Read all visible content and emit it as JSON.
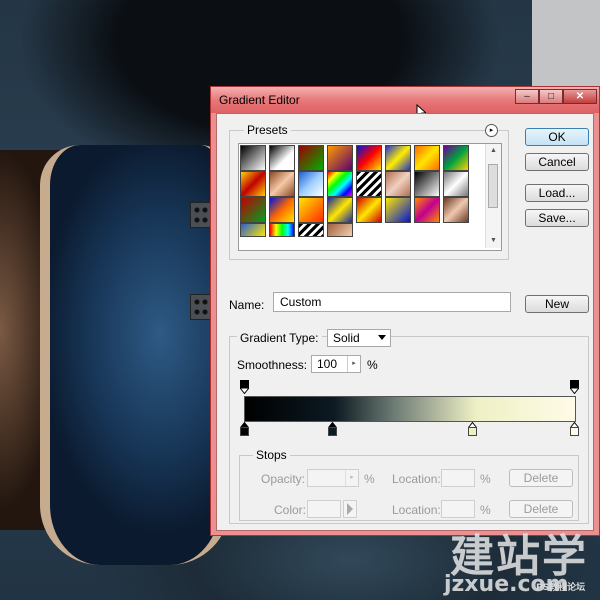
{
  "window": {
    "title": "Gradient Editor",
    "min_glyph": "‒",
    "max_glyph": "□",
    "close_glyph": "✕"
  },
  "presets": {
    "label": "Presets",
    "menu_glyph": "▸"
  },
  "buttons": {
    "ok": "OK",
    "cancel": "Cancel",
    "load": "Load...",
    "save": "Save...",
    "new": "New"
  },
  "name": {
    "label": "Name:",
    "value": "Custom"
  },
  "gradient_type": {
    "label": "Gradient Type:",
    "value": "Solid"
  },
  "smoothness": {
    "label": "Smoothness:",
    "value": "100",
    "unit": "%"
  },
  "stops": {
    "label": "Stops",
    "opacity_label": "Opacity:",
    "opacity_unit": "%",
    "location_label": "Location:",
    "location_unit": "%",
    "color_label": "Color:",
    "delete_label": "Delete"
  },
  "gradient_colors": [
    "#000000",
    "#0c1a22",
    "#eef0c4",
    "#fffbe8"
  ],
  "watermark": {
    "main": "建站学",
    "domain": "jzxue.com",
    "tag": "PS教程论坛"
  }
}
